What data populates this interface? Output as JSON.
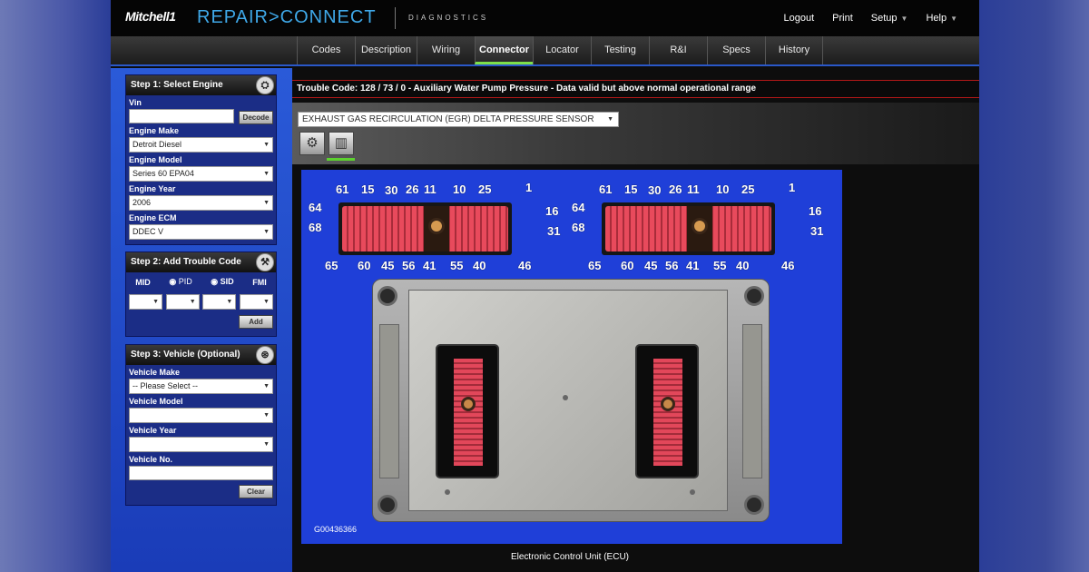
{
  "header": {
    "brand": "Mitchell1",
    "product_left": "REPAIR",
    "product_sep": ">",
    "product_right": "CONNECT",
    "subtitle": "DIAGNOSTICS",
    "links": [
      "Logout",
      "Print",
      "Setup",
      "Help"
    ]
  },
  "tabs": [
    "Codes",
    "Description",
    "Wiring",
    "Connector",
    "Locator",
    "Testing",
    "R&I",
    "Specs",
    "History"
  ],
  "active_tab": "Connector",
  "accent": {
    "highlight": "#7ee04a",
    "sidebar_blue": "#2a5ad8",
    "trouble_border": "#b21818"
  },
  "step1": {
    "title": "Step 1: Select Engine",
    "vin_label": "Vin",
    "vin_value": "",
    "decode_label": "Decode",
    "make_label": "Engine Make",
    "make_value": "Detroit Diesel",
    "model_label": "Engine Model",
    "model_value": "Series 60 EPA04",
    "year_label": "Engine Year",
    "year_value": "2006",
    "ecm_label": "Engine ECM",
    "ecm_value": "DDEC V"
  },
  "step2": {
    "title": "Step 2: Add Trouble Code",
    "mid_label": "MID",
    "pid_label": "PID",
    "sid_label": "SID",
    "fmi_label": "FMI",
    "add_label": "Add"
  },
  "step3": {
    "title": "Step 3: Vehicle (Optional)",
    "make_label": "Vehicle Make",
    "make_value": "-- Please Select --",
    "model_label": "Vehicle Model",
    "year_label": "Vehicle Year",
    "no_label": "Vehicle No.",
    "clear_label": "Clear"
  },
  "trouble_code": "Trouble Code: 128 / 73 / 0 - Auxiliary Water Pump Pressure - Data valid but above normal operational range",
  "component": "EXHAUST GAS RECIRCULATION (EGR) DELTA PRESSURE SENSOR",
  "diagram": {
    "code": "G00436366",
    "caption": "Electronic Control Unit (ECU)",
    "pins_top": [
      "61",
      "15",
      "30",
      "26",
      "11",
      "10",
      "25",
      "1"
    ],
    "pins_left": [
      "64",
      "68"
    ],
    "pins_right": [
      "16",
      "31"
    ],
    "pins_bottom": [
      "65",
      "60",
      "45",
      "56",
      "41",
      "55",
      "40",
      "46"
    ]
  },
  "icons": {
    "engine": "engine-icon",
    "trouble": "wrench-icon",
    "vehicle": "steering-wheel-icon",
    "tool1": "gear-icon",
    "tool2": "connector-icon"
  }
}
